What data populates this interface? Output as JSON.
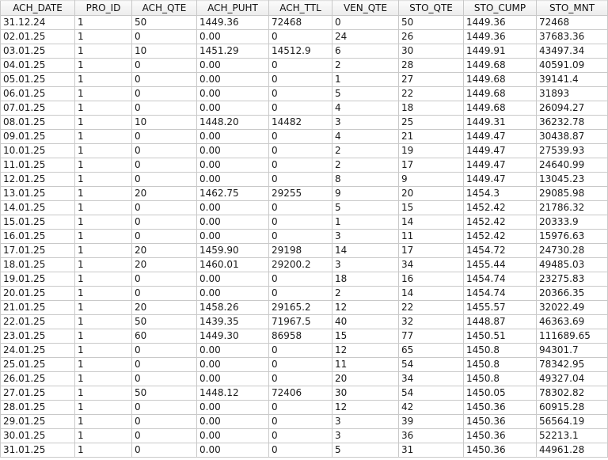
{
  "table": {
    "columns": [
      "ACH_DATE",
      "PRO_ID",
      "ACH_QTE",
      "ACH_PUHT",
      "ACH_TTL",
      "VEN_QTE",
      "STO_QTE",
      "STO_CUMP",
      "STO_MNT"
    ],
    "rows": [
      [
        "31.12.24",
        "1",
        "50",
        "1449.36",
        "72468",
        "0",
        "50",
        "1449.36",
        "72468"
      ],
      [
        "02.01.25",
        "1",
        "0",
        "0.00",
        "0",
        "24",
        "26",
        "1449.36",
        "37683.36"
      ],
      [
        "03.01.25",
        "1",
        "10",
        "1451.29",
        "14512.9",
        "6",
        "30",
        "1449.91",
        "43497.34"
      ],
      [
        "04.01.25",
        "1",
        "0",
        "0.00",
        "0",
        "2",
        "28",
        "1449.68",
        "40591.09"
      ],
      [
        "05.01.25",
        "1",
        "0",
        "0.00",
        "0",
        "1",
        "27",
        "1449.68",
        "39141.4"
      ],
      [
        "06.01.25",
        "1",
        "0",
        "0.00",
        "0",
        "5",
        "22",
        "1449.68",
        "31893"
      ],
      [
        "07.01.25",
        "1",
        "0",
        "0.00",
        "0",
        "4",
        "18",
        "1449.68",
        "26094.27"
      ],
      [
        "08.01.25",
        "1",
        "10",
        "1448.20",
        "14482",
        "3",
        "25",
        "1449.31",
        "36232.78"
      ],
      [
        "09.01.25",
        "1",
        "0",
        "0.00",
        "0",
        "4",
        "21",
        "1449.47",
        "30438.87"
      ],
      [
        "10.01.25",
        "1",
        "0",
        "0.00",
        "0",
        "2",
        "19",
        "1449.47",
        "27539.93"
      ],
      [
        "11.01.25",
        "1",
        "0",
        "0.00",
        "0",
        "2",
        "17",
        "1449.47",
        "24640.99"
      ],
      [
        "12.01.25",
        "1",
        "0",
        "0.00",
        "0",
        "8",
        "9",
        "1449.47",
        "13045.23"
      ],
      [
        "13.01.25",
        "1",
        "20",
        "1462.75",
        "29255",
        "9",
        "20",
        "1454.3",
        "29085.98"
      ],
      [
        "14.01.25",
        "1",
        "0",
        "0.00",
        "0",
        "5",
        "15",
        "1452.42",
        "21786.32"
      ],
      [
        "15.01.25",
        "1",
        "0",
        "0.00",
        "0",
        "1",
        "14",
        "1452.42",
        "20333.9"
      ],
      [
        "16.01.25",
        "1",
        "0",
        "0.00",
        "0",
        "3",
        "11",
        "1452.42",
        "15976.63"
      ],
      [
        "17.01.25",
        "1",
        "20",
        "1459.90",
        "29198",
        "14",
        "17",
        "1454.72",
        "24730.28"
      ],
      [
        "18.01.25",
        "1",
        "20",
        "1460.01",
        "29200.2",
        "3",
        "34",
        "1455.44",
        "49485.03"
      ],
      [
        "19.01.25",
        "1",
        "0",
        "0.00",
        "0",
        "18",
        "16",
        "1454.74",
        "23275.83"
      ],
      [
        "20.01.25",
        "1",
        "0",
        "0.00",
        "0",
        "2",
        "14",
        "1454.74",
        "20366.35"
      ],
      [
        "21.01.25",
        "1",
        "20",
        "1458.26",
        "29165.2",
        "12",
        "22",
        "1455.57",
        "32022.49"
      ],
      [
        "22.01.25",
        "1",
        "50",
        "1439.35",
        "71967.5",
        "40",
        "32",
        "1448.87",
        "46363.69"
      ],
      [
        "23.01.25",
        "1",
        "60",
        "1449.30",
        "86958",
        "15",
        "77",
        "1450.51",
        "111689.65"
      ],
      [
        "24.01.25",
        "1",
        "0",
        "0.00",
        "0",
        "12",
        "65",
        "1450.8",
        "94301.7"
      ],
      [
        "25.01.25",
        "1",
        "0",
        "0.00",
        "0",
        "11",
        "54",
        "1450.8",
        "78342.95"
      ],
      [
        "26.01.25",
        "1",
        "0",
        "0.00",
        "0",
        "20",
        "34",
        "1450.8",
        "49327.04"
      ],
      [
        "27.01.25",
        "1",
        "50",
        "1448.12",
        "72406",
        "30",
        "54",
        "1450.05",
        "78302.82"
      ],
      [
        "28.01.25",
        "1",
        "0",
        "0.00",
        "0",
        "12",
        "42",
        "1450.36",
        "60915.28"
      ],
      [
        "29.01.25",
        "1",
        "0",
        "0.00",
        "0",
        "3",
        "39",
        "1450.36",
        "56564.19"
      ],
      [
        "30.01.25",
        "1",
        "0",
        "0.00",
        "0",
        "3",
        "36",
        "1450.36",
        "52213.1"
      ],
      [
        "31.01.25",
        "1",
        "0",
        "0.00",
        "0",
        "5",
        "31",
        "1450.36",
        "44961.28"
      ]
    ]
  }
}
